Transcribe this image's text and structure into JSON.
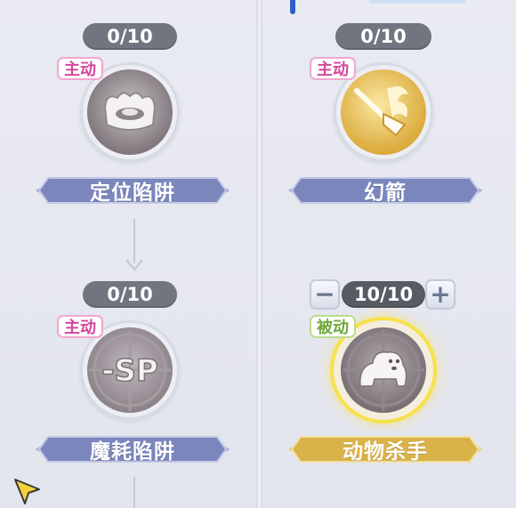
{
  "skills": [
    {
      "level": "0/10",
      "type": "主动",
      "name": "定位陷阱"
    },
    {
      "level": "0/10",
      "type": "主动",
      "name": "幻箭"
    },
    {
      "level": "0/10",
      "type": "主动",
      "name": "魔耗陷阱",
      "icon_text": "-SP"
    },
    {
      "level": "10/10",
      "type": "被动",
      "name": "动物杀手",
      "decrease": "−",
      "increase": "+"
    }
  ],
  "colors": {
    "active_tag": "#d4479a",
    "passive_tag": "#6fa83c",
    "banner_blue": "#7b86bc",
    "banner_gold": "#d9b24a",
    "glow": "#f7e14b"
  },
  "icons": [
    "trap-icon",
    "arrow-icon",
    "sp-drain-icon",
    "beast-icon",
    "cursor-icon"
  ]
}
